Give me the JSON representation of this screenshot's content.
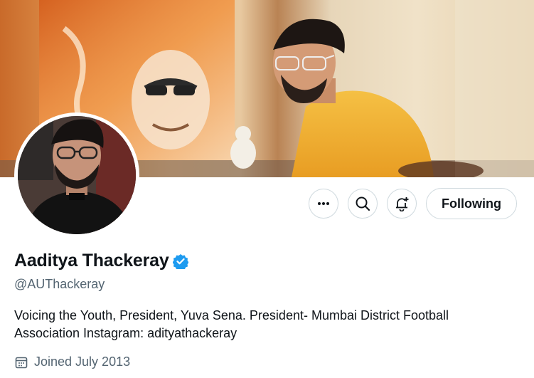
{
  "profile": {
    "name": "Aaditya Thackeray",
    "handle": "@AUThackeray",
    "bio": "Voicing the Youth, President, Yuva Sena. President- Mumbai District Football Association Instagram: adityathackeray",
    "joined": "Joined July 2013"
  },
  "actions": {
    "more_icon": "more-icon",
    "search_icon": "search-icon",
    "notify_icon": "notification-bell-icon",
    "following_label": "Following"
  },
  "colors": {
    "verified": "#1d9bf0",
    "muted_text": "#536471",
    "border": "#cfd9de"
  }
}
